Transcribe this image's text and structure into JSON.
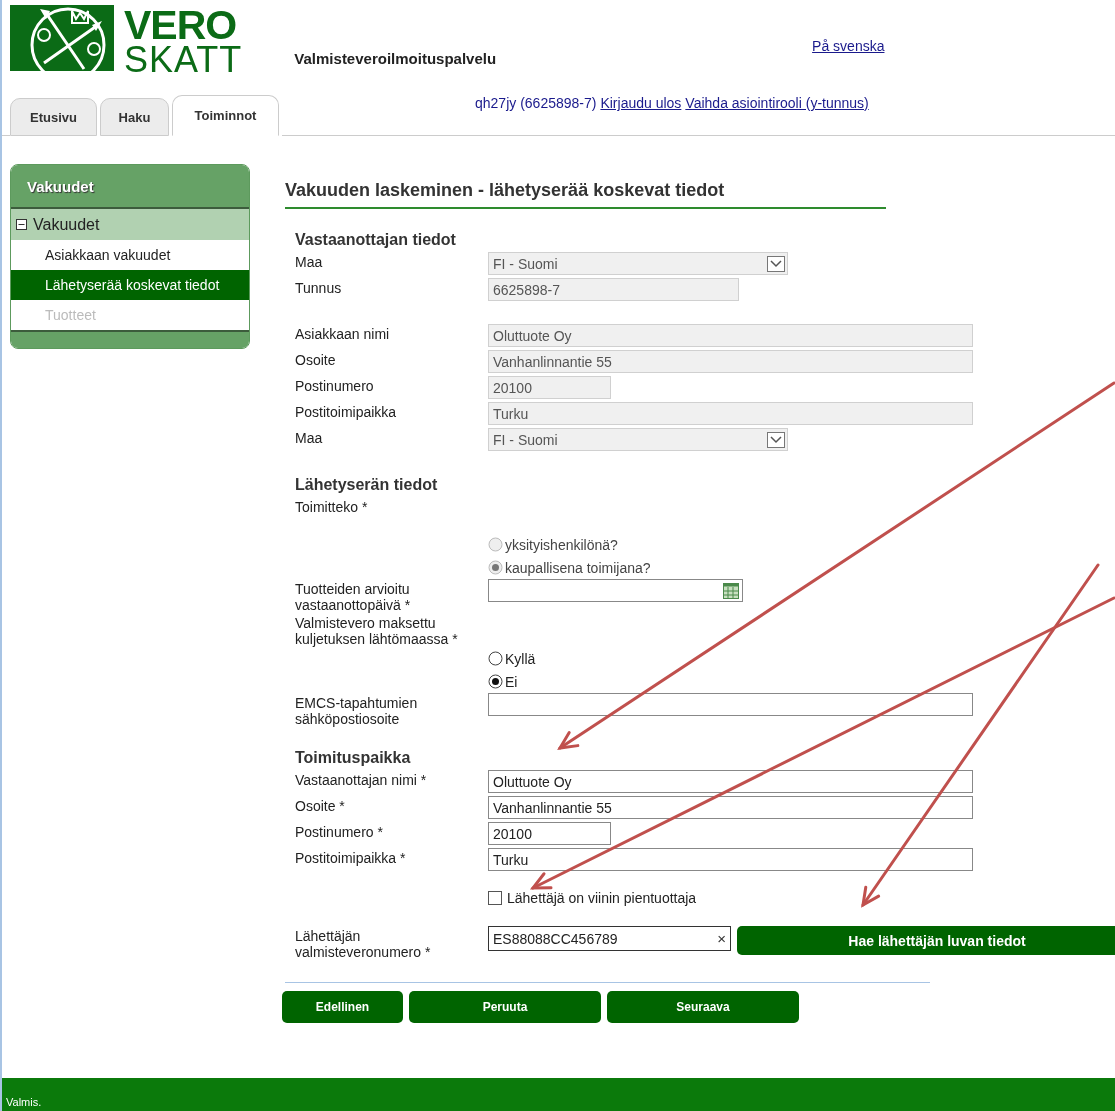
{
  "header": {
    "logo_top": "VERO",
    "logo_bottom": "SKATT",
    "service_title": "Valmisteveroilmoituspalvelu",
    "language_link": "På svenska",
    "user": "qh27jy (6625898-7)",
    "links": [
      "Kirjaudu ulos",
      "Vaihda asiointirooli (y-tunnus)"
    ]
  },
  "tabs": [
    {
      "label": "Etusivu",
      "selected": false
    },
    {
      "label": "Haku",
      "selected": false
    },
    {
      "label": "Toiminnot",
      "selected": true
    }
  ],
  "sidebar": {
    "title": "Vakuudet",
    "group": {
      "label": "Vakuudet",
      "expanded": true,
      "children": [
        {
          "label": "Asiakkaan vakuudet",
          "selected": false,
          "disabled": false
        },
        {
          "label": "Lähetyserää koskevat tiedot",
          "selected": true,
          "disabled": false
        },
        {
          "label": "Tuotteet",
          "selected": false,
          "disabled": true
        }
      ]
    }
  },
  "page_title": "Vakuuden laskeminen - lähetyserää koskevat tiedot",
  "sections": [
    {
      "heading": "Vastaanottajan tiedot",
      "rows": [
        {
          "kind": "select",
          "label": "Maa",
          "value": "FI - Suomi",
          "disabled": true
        },
        {
          "kind": "medium",
          "label": "Tunnus",
          "value": "6625898-7",
          "disabled": true
        }
      ]
    },
    {
      "rows": [
        {
          "kind": "text",
          "label": "Asiakkaan nimi",
          "value": "Oluttuote Oy",
          "disabled": true
        },
        {
          "kind": "text",
          "label": "Osoite",
          "value": "Vanhanlinnantie 55",
          "disabled": true
        },
        {
          "kind": "short",
          "label": "Postinumero",
          "value": "20100",
          "disabled": true
        },
        {
          "kind": "text",
          "label": "Postitoimipaikka",
          "value": "Turku",
          "disabled": true
        },
        {
          "kind": "select",
          "label": "Maa",
          "value": "FI - Suomi",
          "disabled": true
        }
      ]
    },
    {
      "heading": "Lähetyserän tiedot",
      "rows": [
        {
          "kind": "radio",
          "label": "Toimitteko *",
          "options": [
            {
              "label": "yksityishenkilönä?",
              "selected": false,
              "disabled": true
            },
            {
              "label": "kaupallisena toimijana?",
              "selected": true,
              "disabled": true
            }
          ]
        },
        {
          "kind": "date",
          "label": "Tuotteiden arvioitu vastaanottopäivä *"
        },
        {
          "kind": "radio",
          "label": "Valmistevero maksettu kuljetuksen lähtömaassa *",
          "options": [
            {
              "label": "Kyllä",
              "selected": false,
              "disabled": false
            },
            {
              "label": "Ei",
              "selected": true,
              "disabled": false
            }
          ]
        },
        {
          "kind": "text",
          "label": "EMCS-tapahtumien sähköpostiosoite",
          "disabled": false
        }
      ]
    },
    {
      "heading": "Toimituspaikka",
      "rows": [
        {
          "kind": "text",
          "label": "Vastaanottajan nimi *",
          "value": "Oluttuote Oy",
          "disabled": false
        },
        {
          "kind": "text",
          "label": "Osoite *",
          "value": "Vanhanlinnantie 55",
          "disabled": false
        },
        {
          "kind": "short",
          "label": "Postinumero *",
          "value": "20100",
          "disabled": false
        },
        {
          "kind": "text",
          "label": "Postitoimipaikka *",
          "value": "Turku",
          "disabled": false
        },
        {
          "kind": "checkbox",
          "option": "Lähettäjä on viinin pientuottaja",
          "checked": false
        },
        {
          "kind": "lookup",
          "label": "Lähettäjän valmisteveronumero *",
          "value": "ES88088CC456789",
          "clear": "×",
          "button": "Hae lähettäjän luvan tiedot"
        }
      ]
    }
  ],
  "buttons": [
    "Edellinen",
    "Peruuta",
    "Seuraava"
  ],
  "status_bar": "Valmis."
}
